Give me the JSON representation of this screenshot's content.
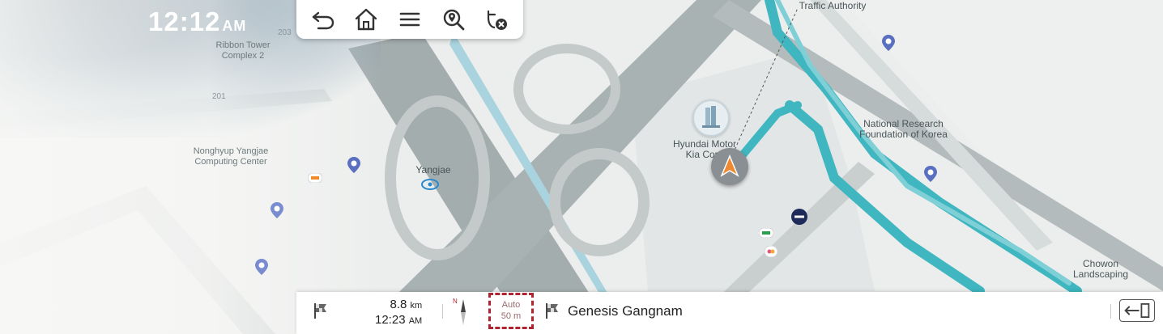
{
  "status": {
    "time": "12:12",
    "ampm": "AM"
  },
  "toolbar": {
    "buttons": [
      {
        "name": "back-button",
        "icon": "back-arrow-icon"
      },
      {
        "name": "home-button",
        "icon": "home-icon"
      },
      {
        "name": "menu-button",
        "icon": "menu-icon"
      },
      {
        "name": "search-button",
        "icon": "search-pin-icon"
      },
      {
        "name": "cancel-route-button",
        "icon": "cancel-route-icon"
      }
    ]
  },
  "map_labels": {
    "ribbon_tower": "Ribbon Tower Complex 2",
    "num_203": "203",
    "num_201": "201",
    "nonghyup": "Nonghyup Yangjae Computing Center",
    "yangjae": "Yangjae",
    "hyundai": "Hyundai Motor Kia Corp",
    "traffic": "Traffic Authority",
    "national_research": "National Research Foundation of Korea",
    "chowon": "Chowon Landscaping"
  },
  "route": {
    "distance_value": "8.8",
    "distance_unit": "km",
    "eta_time": "12:23",
    "eta_ampm": "AM",
    "compass_label": "N",
    "scale_mode": "Auto",
    "scale_value": "50 m",
    "destination": "Genesis Gangnam"
  },
  "colors": {
    "route": "#3fb6c0",
    "accent_red": "#b1232e"
  }
}
